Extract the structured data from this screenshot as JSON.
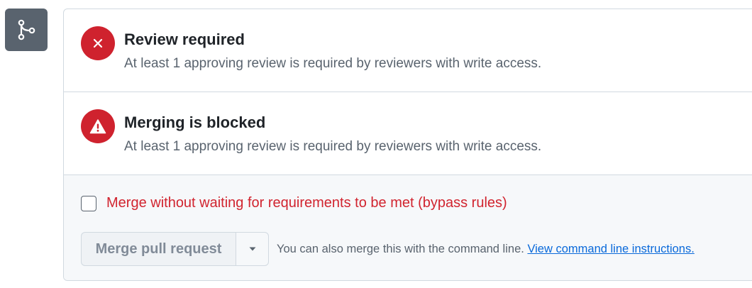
{
  "icons": {
    "merge": "git-merge-icon",
    "review_status": "x-icon",
    "blocked_status": "alert-icon",
    "dropdown": "triangle-down-icon"
  },
  "colors": {
    "danger": "#cf222e",
    "muted": "#59636e",
    "link": "#0969da"
  },
  "review": {
    "title": "Review required",
    "description": "At least 1 approving review is required by reviewers with write access."
  },
  "blocked": {
    "title": "Merging is blocked",
    "description": "At least 1 approving review is required by reviewers with write access."
  },
  "bypass": {
    "label": "Merge without waiting for requirements to be met (bypass rules)",
    "checked": false
  },
  "merge_button": {
    "label": "Merge pull request"
  },
  "cli": {
    "text": "You can also merge this with the command line.",
    "link": "View command line instructions."
  }
}
